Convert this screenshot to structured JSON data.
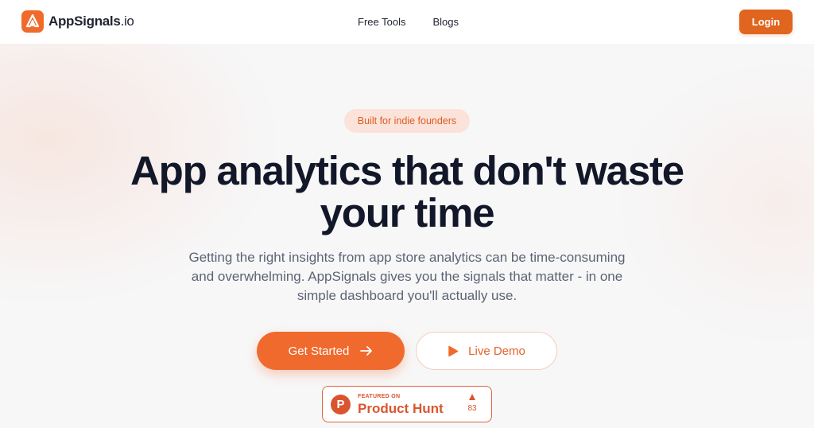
{
  "brand": {
    "name": "AppSignals",
    "tld": ".io",
    "accent": "#f06a2b"
  },
  "nav": {
    "items": [
      {
        "label": "Free Tools"
      },
      {
        "label": "Blogs"
      }
    ],
    "login_label": "Login"
  },
  "hero": {
    "badge": "Built for indie founders",
    "title_line1": "App analytics that don't waste",
    "title_line2": "your time",
    "subtitle": "Getting the right insights from app store analytics can be time-consuming and overwhelming. AppSignals gives you the signals that matter - in one simple dashboard you'll actually use.",
    "cta_primary": "Get Started",
    "cta_secondary": "Live Demo"
  },
  "product_hunt": {
    "featured_label": "FEATURED ON",
    "name": "Product Hunt",
    "logo_letter": "P",
    "votes": "83",
    "color": "#da552f"
  }
}
